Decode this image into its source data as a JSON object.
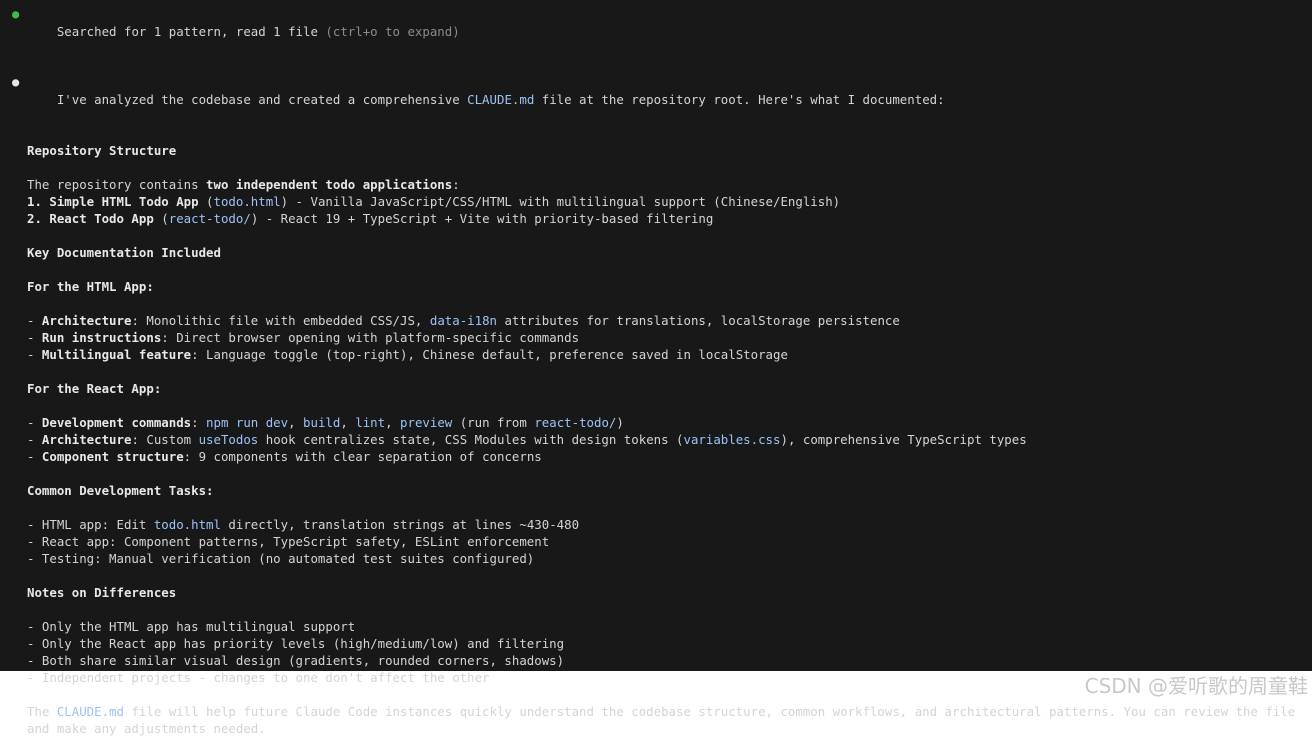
{
  "status": {
    "text": "Searched for 1 pattern, read 1 file",
    "hint": "(ctrl+o to expand)"
  },
  "intro": {
    "before": "I've analyzed the codebase and created a comprehensive ",
    "file": "CLAUDE.md",
    "after": " file at the repository root. Here's what I documented:"
  },
  "repo": {
    "heading": "Repository Structure",
    "lead_before": "The repository contains ",
    "lead_bold": "two independent todo applications",
    "lead_after": ":",
    "app1_bold": "1. Simple HTML Todo App",
    "app1_open": " (",
    "app1_code": "todo.html",
    "app1_rest": ") - Vanilla JavaScript/CSS/HTML with multilingual support (Chinese/English)",
    "app2_bold": "2. React Todo App",
    "app2_open": " (",
    "app2_code": "react-todo/",
    "app2_rest": ") - React 19 + TypeScript + Vite with priority-based filtering"
  },
  "keydocs": {
    "heading": "Key Documentation Included"
  },
  "html_app": {
    "heading": "For the HTML App:",
    "arch_prefix": "- ",
    "arch_bold": "Architecture",
    "arch_a": ": Monolithic file with embedded CSS/JS, ",
    "arch_code": "data-i18n",
    "arch_b": " attributes for translations, localStorage persistence",
    "run_prefix": "- ",
    "run_bold": "Run instructions",
    "run_rest": ": Direct browser opening with platform-specific commands",
    "multi_prefix": "- ",
    "multi_bold": "Multilingual feature",
    "multi_rest": ": Language toggle (top-right), Chinese default, preference saved in localStorage"
  },
  "react_app": {
    "heading": "For the React App:",
    "dev_prefix": "- ",
    "dev_bold": "Development commands",
    "dev_sep0": ": ",
    "dev_c1": "npm run dev",
    "dev_sep1": ", ",
    "dev_c2": "build",
    "dev_sep2": ", ",
    "dev_c3": "lint",
    "dev_sep3": ", ",
    "dev_c4": "preview",
    "dev_sep4": " (run from ",
    "dev_c5": "react-todo/",
    "dev_sep5": ")",
    "arch_prefix": "- ",
    "arch_bold": "Architecture",
    "arch_a": ": Custom ",
    "arch_c1": "useTodos",
    "arch_b": " hook centralizes state, CSS Modules with design tokens (",
    "arch_c2": "variables.css",
    "arch_c": "), comprehensive TypeScript types",
    "comp_prefix": "- ",
    "comp_bold": "Component structure",
    "comp_rest": ": 9 components with clear separation of concerns"
  },
  "tasks": {
    "heading": "Common Development Tasks:",
    "t1_a": "- HTML app: Edit ",
    "t1_code": "todo.html",
    "t1_b": " directly, translation strings at lines ~430-480",
    "t2": "- React app: Component patterns, TypeScript safety, ESLint enforcement",
    "t3": "- Testing: Manual verification (no automated test suites configured)"
  },
  "notes": {
    "heading": "Notes on Differences",
    "n1": "- Only the HTML app has multilingual support",
    "n2": "- Only the React app has priority levels (high/medium/low) and filtering",
    "n3": "- Both share similar visual design (gradients, rounded corners, shadows)",
    "n4": "- Independent projects - changes to one don't affect the other"
  },
  "closing": {
    "before": "The ",
    "file": "CLAUDE.md",
    "after": " file will help future Claude Code instances quickly understand the codebase structure, common workflows, and architectural patterns. You can review the file and make any adjustments needed."
  },
  "watermark": "CSDN @爱听歌的周童鞋",
  "colors": {
    "background": "#181818",
    "text": "#d4d4d4",
    "code": "#9cc3f5",
    "status_dot": "#3fb950"
  }
}
